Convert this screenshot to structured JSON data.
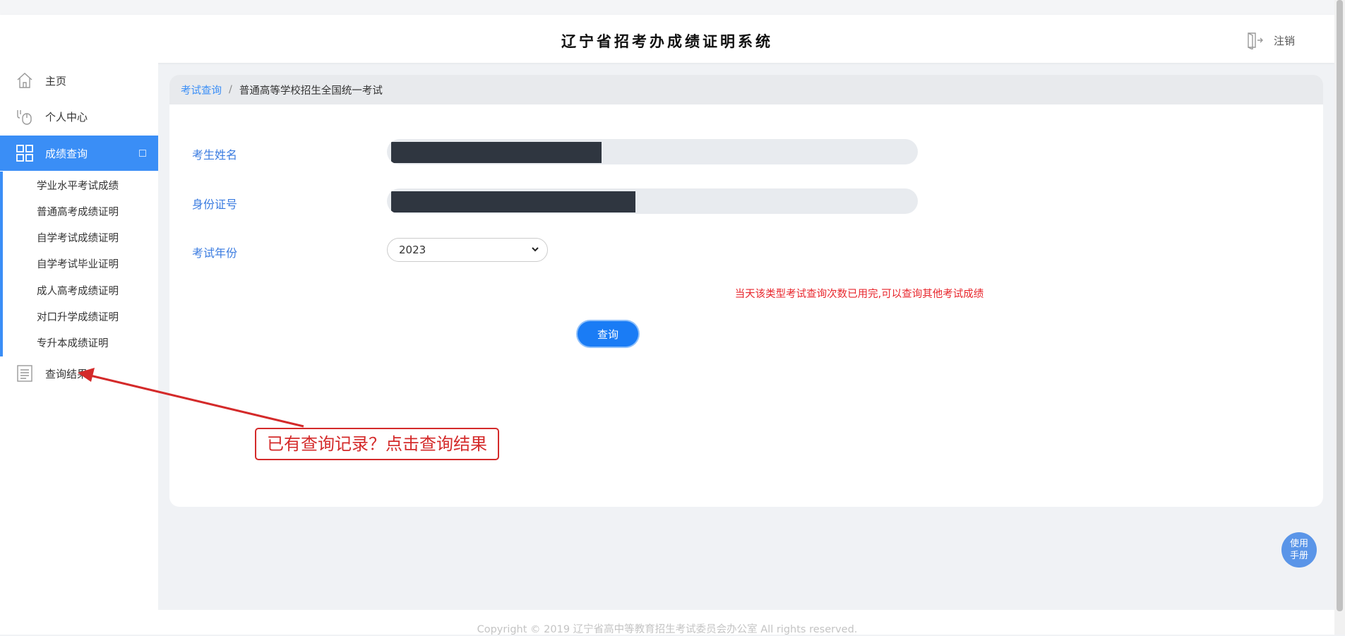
{
  "header": {
    "title": "辽宁省招考办成绩证明系统",
    "logout_label": "注销"
  },
  "sidebar": {
    "items": [
      {
        "label": "主页",
        "icon": "home-icon"
      },
      {
        "label": "个人中心",
        "icon": "user-center-icon"
      },
      {
        "label": "成绩查询",
        "icon": "grid-icon"
      }
    ],
    "submenu": [
      "学业水平考试成绩",
      "普通高考成绩证明",
      "自学考试成绩证明",
      "自学考试毕业证明",
      "成人高考成绩证明",
      "对口升学成绩证明",
      "专升本成绩证明"
    ],
    "results": {
      "label": "查询结果",
      "icon": "document-icon"
    }
  },
  "breadcrumb": {
    "link": "考试查询",
    "separator": "/",
    "current": "普通高等学校招生全国统一考试"
  },
  "form": {
    "name_label": "考生姓名",
    "id_label": "身份证号",
    "year_label": "考试年份",
    "year_value": "2023",
    "error_message": "当天该类型考试查询次数已用完,可以查询其他考试成绩",
    "submit_label": "查询"
  },
  "annotation": {
    "text": "已有查询记录？点击查询结果",
    "color": "#d42a2a"
  },
  "manual_button": {
    "line1": "使用",
    "line2": "手册"
  },
  "footer": {
    "copyright": "Copyright © 2019 辽宁省高中等教育招生考试委员会办公室 All rights reserved."
  },
  "colors": {
    "accent": "#3a8ef6",
    "error": "#e8262c",
    "button": "#1a7cf5"
  }
}
